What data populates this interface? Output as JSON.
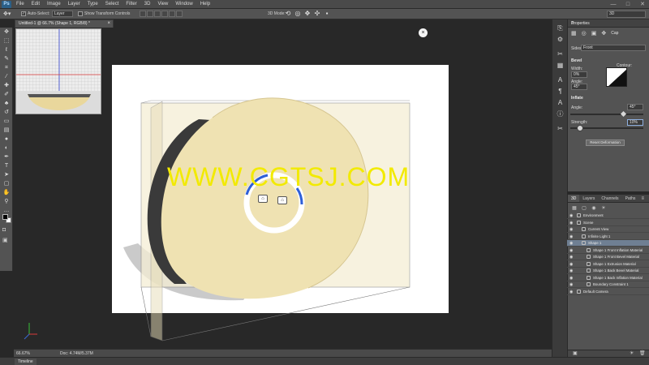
{
  "app": {
    "logo": "Ps"
  },
  "menu": [
    "File",
    "Edit",
    "Image",
    "Layer",
    "Type",
    "Select",
    "Filter",
    "3D",
    "View",
    "Window",
    "Help"
  ],
  "window_controls": [
    "—",
    "□",
    "✕"
  ],
  "options_bar": {
    "auto_select_label": "Auto-Select:",
    "auto_select_checked": true,
    "auto_select_target": "Layer",
    "show_transform_label": "Show Transform Controls",
    "mode_3d_label": "3D Mode:",
    "workspace": "3D"
  },
  "document": {
    "tab_title": "Untitled-1 @ 66.7% (Shape 1, RGB/8) *",
    "zoom": "66.67%",
    "doc_info": "Doc: 4.74M/5.37M"
  },
  "watermark": "WWW.CGTSJ.COM",
  "timeline_tab": "Timeline",
  "properties": {
    "title": "Properties",
    "cap_label": "Cap",
    "sides_label": "Sides:",
    "sides_value": "Front",
    "bevel_label": "Bevel",
    "width_label": "Width:",
    "width_value": "0%",
    "contour_label": "Contour:",
    "angle_label": "Angle:",
    "angle_value": "45°",
    "inflate_label": "Inflate",
    "inflate_angle_label": "Angle:",
    "inflate_angle_value": "45°",
    "strength_label": "Strength:",
    "strength_value": "10%",
    "reset_label": "Reset Deformation"
  },
  "layers_panel": {
    "tabs": [
      "3D",
      "Layers",
      "Channels",
      "Paths"
    ],
    "active_tab": "3D",
    "items": [
      {
        "name": "Environment",
        "indent": 0,
        "selected": false
      },
      {
        "name": "Scene",
        "indent": 0,
        "selected": false
      },
      {
        "name": "Current View",
        "indent": 1,
        "selected": false
      },
      {
        "name": "Infinite Light 1",
        "indent": 1,
        "selected": false
      },
      {
        "name": "Shape 1",
        "indent": 1,
        "selected": true
      },
      {
        "name": "Shape 1 Front Inflation Material",
        "indent": 2,
        "selected": false
      },
      {
        "name": "Shape 1 Front Bevel Material",
        "indent": 2,
        "selected": false
      },
      {
        "name": "Shape 1 Extrusion Material",
        "indent": 2,
        "selected": false
      },
      {
        "name": "Shape 1 Back Bevel Material",
        "indent": 2,
        "selected": false
      },
      {
        "name": "Shape 1 Back Inflation Material",
        "indent": 2,
        "selected": false
      },
      {
        "name": "Boundary Constraint 1",
        "indent": 2,
        "selected": false
      },
      {
        "name": "Default Camera",
        "indent": 0,
        "selected": false
      }
    ]
  },
  "colors": {
    "accent": "#6f7f93",
    "shape_fill": "#efe2b2",
    "watermark": "#f2ea00"
  }
}
